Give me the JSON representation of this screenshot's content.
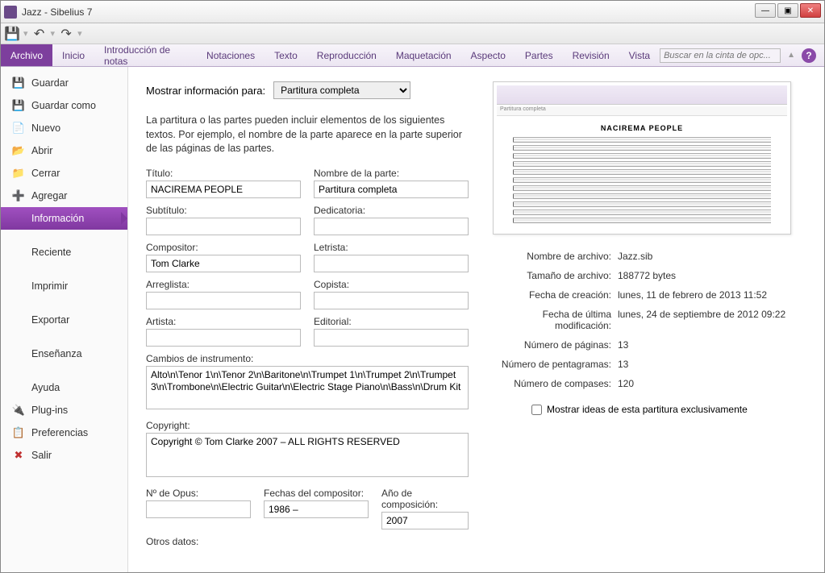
{
  "window": {
    "title": "Jazz - Sibelius 7"
  },
  "ribbon": {
    "tabs": [
      "Archivo",
      "Inicio",
      "Introducción de notas",
      "Notaciones",
      "Texto",
      "Reproducción",
      "Maquetación",
      "Aspecto",
      "Partes",
      "Revisión",
      "Vista"
    ],
    "search_placeholder": "Buscar en la cinta de opc..."
  },
  "sidebar": {
    "items": [
      {
        "label": "Guardar",
        "icon": "💾"
      },
      {
        "label": "Guardar como",
        "icon": "💾"
      },
      {
        "label": "Nuevo",
        "icon": "📄"
      },
      {
        "label": "Abrir",
        "icon": "📂"
      },
      {
        "label": "Cerrar",
        "icon": "📁"
      },
      {
        "label": "Agregar",
        "icon": "➕"
      }
    ],
    "informacion": "Información",
    "plain": [
      "Reciente",
      "Imprimir",
      "Exportar",
      "Enseñanza",
      "Ayuda"
    ],
    "bottom": [
      {
        "label": "Plug-ins",
        "icon": "🔌"
      },
      {
        "label": "Preferencias",
        "icon": "📋"
      },
      {
        "label": "Salir",
        "icon": "✖"
      }
    ]
  },
  "form": {
    "show_for_label": "Mostrar información para:",
    "show_for_value": "Partitura completa",
    "desc": "La partitura o las partes pueden incluir elementos de los siguientes textos. Por ejemplo, el nombre de la parte aparece en la parte superior de las páginas de las partes.",
    "fields": {
      "titulo": {
        "label": "Título:",
        "value": "NACIREMA PEOPLE"
      },
      "nombre_parte": {
        "label": "Nombre de la parte:",
        "value": "Partitura completa"
      },
      "subtitulo": {
        "label": "Subtítulo:",
        "value": ""
      },
      "dedicatoria": {
        "label": "Dedicatoria:",
        "value": ""
      },
      "compositor": {
        "label": "Compositor:",
        "value": "Tom Clarke"
      },
      "letrista": {
        "label": "Letrista:",
        "value": ""
      },
      "arreglista": {
        "label": "Arreglista:",
        "value": ""
      },
      "copista": {
        "label": "Copista:",
        "value": ""
      },
      "artista": {
        "label": "Artista:",
        "value": ""
      },
      "editorial": {
        "label": "Editorial:",
        "value": ""
      },
      "cambios": {
        "label": "Cambios de instrumento:",
        "value": "Alto\\n\\Tenor 1\\n\\Tenor 2\\n\\Baritone\\n\\Trumpet 1\\n\\Trumpet 2\\n\\Trumpet 3\\n\\Trombone\\n\\Electric Guitar\\n\\Electric Stage Piano\\n\\Bass\\n\\Drum Kit"
      },
      "copyright": {
        "label": "Copyright:",
        "value": "Copyright © Tom Clarke 2007 – ALL RIGHTS RESERVED"
      },
      "opus": {
        "label": "Nº de Opus:",
        "value": ""
      },
      "fechas_comp": {
        "label": "Fechas del compositor:",
        "value": "1986 –"
      },
      "anio": {
        "label": "Año de composición:",
        "value": "2007"
      },
      "otros": {
        "label": "Otros datos:"
      }
    }
  },
  "preview": {
    "score_title": "NACIREMA PEOPLE",
    "tab": "Partitura completa"
  },
  "meta": {
    "rows": [
      {
        "label": "Nombre de archivo:",
        "value": "Jazz.sib"
      },
      {
        "label": "Tamaño de archivo:",
        "value": "188772 bytes"
      },
      {
        "label": "Fecha de creación:",
        "value": "lunes, 11 de febrero de 2013 11:52"
      },
      {
        "label": "Fecha de última modificación:",
        "value": "lunes, 24 de septiembre de 2012 09:22"
      },
      {
        "label": "Número de páginas:",
        "value": "13"
      },
      {
        "label": "Número de pentagramas:",
        "value": "13"
      },
      {
        "label": "Número de compases:",
        "value": "120"
      }
    ],
    "checkbox": "Mostrar ideas de esta partitura exclusivamente"
  }
}
